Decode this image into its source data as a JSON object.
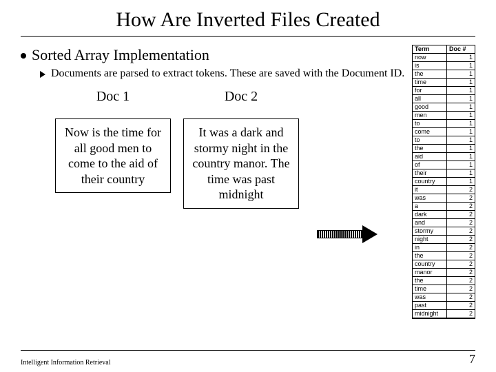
{
  "title": "How Are Inverted Files Created",
  "bullet1": "Sorted Array Implementation",
  "bullet2": "Documents are parsed to extract tokens. These are saved with the Document ID.",
  "docs": {
    "doc1": {
      "label": "Doc 1",
      "text": "Now is the time for all good men to come to the aid of their country"
    },
    "doc2": {
      "label": "Doc 2",
      "text": "It was a dark and stormy night in the country manor. The time was past midnight"
    }
  },
  "table": {
    "headers": {
      "term": "Term",
      "doc": "Doc #"
    },
    "rows": [
      {
        "term": "now",
        "doc": "1"
      },
      {
        "term": "is",
        "doc": "1"
      },
      {
        "term": "the",
        "doc": "1"
      },
      {
        "term": "time",
        "doc": "1"
      },
      {
        "term": "for",
        "doc": "1"
      },
      {
        "term": "all",
        "doc": "1"
      },
      {
        "term": "good",
        "doc": "1"
      },
      {
        "term": "men",
        "doc": "1"
      },
      {
        "term": "to",
        "doc": "1"
      },
      {
        "term": "come",
        "doc": "1"
      },
      {
        "term": "to",
        "doc": "1"
      },
      {
        "term": "the",
        "doc": "1"
      },
      {
        "term": "aid",
        "doc": "1"
      },
      {
        "term": "of",
        "doc": "1"
      },
      {
        "term": "their",
        "doc": "1"
      },
      {
        "term": "country",
        "doc": "1"
      },
      {
        "term": "it",
        "doc": "2"
      },
      {
        "term": "was",
        "doc": "2"
      },
      {
        "term": "a",
        "doc": "2"
      },
      {
        "term": "dark",
        "doc": "2"
      },
      {
        "term": "and",
        "doc": "2"
      },
      {
        "term": "stormy",
        "doc": "2"
      },
      {
        "term": "night",
        "doc": "2"
      },
      {
        "term": "in",
        "doc": "2"
      },
      {
        "term": "the",
        "doc": "2"
      },
      {
        "term": "country",
        "doc": "2"
      },
      {
        "term": "manor",
        "doc": "2"
      },
      {
        "term": "the",
        "doc": "2"
      },
      {
        "term": "time",
        "doc": "2"
      },
      {
        "term": "was",
        "doc": "2"
      },
      {
        "term": "past",
        "doc": "2"
      },
      {
        "term": "midnight",
        "doc": "2"
      }
    ]
  },
  "footer": {
    "left": "Intelligent Information Retrieval",
    "right": "7"
  }
}
